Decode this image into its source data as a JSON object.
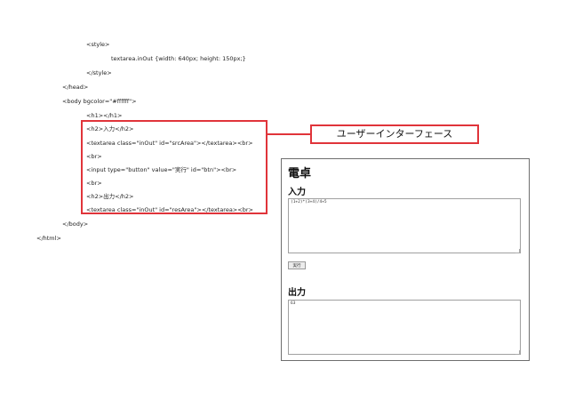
{
  "code": {
    "lines": [
      "<style>",
      "textarea.inOut {width: 640px; height: 150px;}",
      "</style>",
      "</head>",
      "<body bgcolor=\"#ffffff\">",
      "<h1></h1>",
      "<h2>入力</h2>",
      "<textarea class=\"inOut\" id=\"srcArea\"></textarea><br>",
      "<br>",
      "<input type=\"button\" value=\"実行\" id=\"btn\"><br>",
      "<br>",
      "<h2>出力</h2>",
      "<textarea class=\"inOut\" id=\"resArea\"></textarea><br>",
      "</body>",
      "</html>"
    ]
  },
  "callout": {
    "label": "ユーザーインターフェース"
  },
  "colors": {
    "highlight": "#e0343a",
    "browser_border": "#6e6e6e"
  },
  "browser": {
    "title": "電卓",
    "input_heading": "入力",
    "src_value": "(1+2)*(3+4)/4+5",
    "button_label": "実行",
    "output_heading": "出力",
    "res_value": "63"
  }
}
